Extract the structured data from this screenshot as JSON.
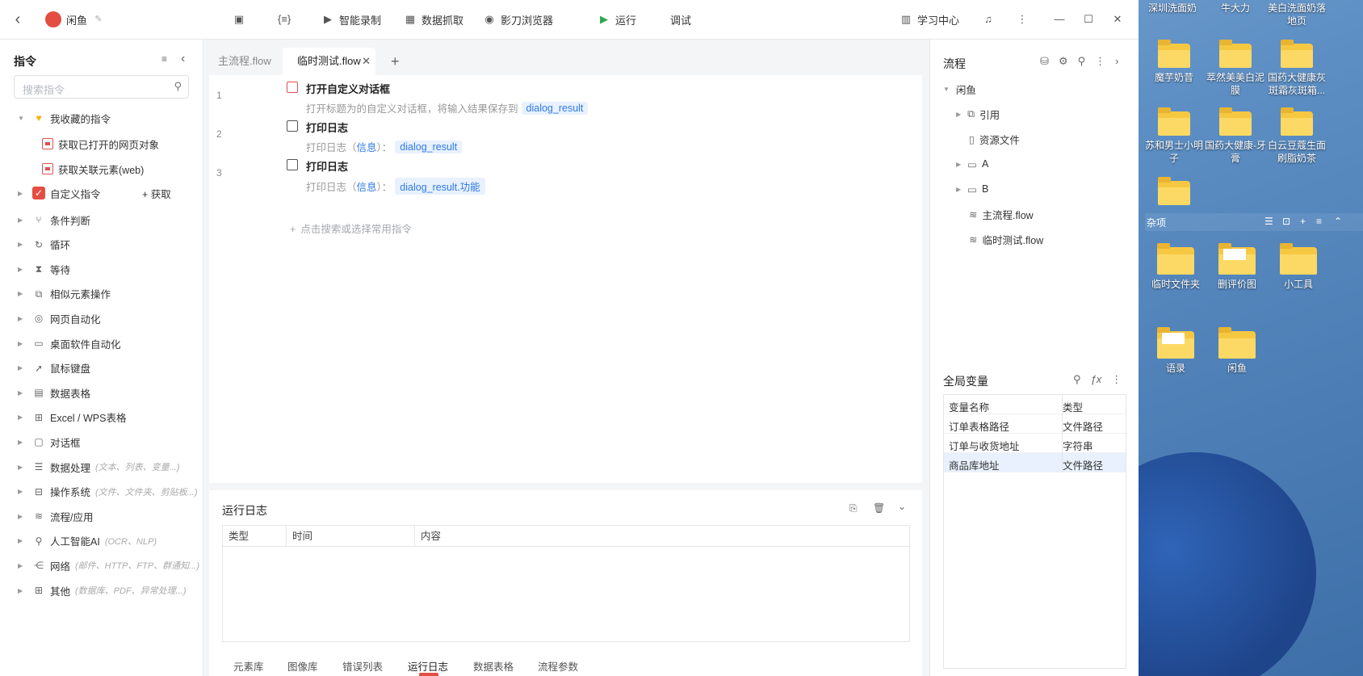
{
  "desktop": {
    "icons_top": [
      {
        "label": "深圳洗面奶"
      },
      {
        "label": "牛大力"
      },
      {
        "label": "美白洗面奶落地页"
      }
    ],
    "icons_row1": [
      {
        "label": "魔芋奶昔"
      },
      {
        "label": "萃然美美白泥膜"
      },
      {
        "label": "国药大健康灰斑霜灰斑箱..."
      }
    ],
    "icons_row2": [
      {
        "label": "苏和男士小明子"
      },
      {
        "label": "国药大健康-牙膏"
      },
      {
        "label": "白云豆蔻生面刷脂奶茶"
      }
    ],
    "group": {
      "label": "杂项"
    },
    "icons_row3": [
      {
        "label": "临时文件夹"
      },
      {
        "label": "删评价图"
      },
      {
        "label": "小工具"
      }
    ],
    "icons_row4": [
      {
        "label": "语录"
      },
      {
        "label": "闲鱼"
      }
    ]
  },
  "titlebar": {
    "back": "‹",
    "app_name": "闲鱼",
    "tools": {
      "smart_record": "智能录制",
      "data_capture": "数据抓取",
      "browser": "影刀浏览器",
      "run": "运行",
      "debug": "调试",
      "learn": "学习中心"
    }
  },
  "left": {
    "title": "指令",
    "search_placeholder": "搜索指令",
    "favorites": "我收藏的指令",
    "fav_items": [
      "获取已打开的网页对象",
      "获取关联元素(web)"
    ],
    "custom": "自定义指令",
    "custom_action": "+ 获取",
    "categories": [
      {
        "label": "条件判断",
        "hint": "",
        "icon": "branch-icon",
        "glyph": "⑂"
      },
      {
        "label": "循环",
        "hint": "",
        "icon": "loop-icon",
        "glyph": "↻"
      },
      {
        "label": "等待",
        "hint": "",
        "icon": "hourglass-icon",
        "glyph": "⧗"
      },
      {
        "label": "相似元素操作",
        "hint": "",
        "icon": "similar-icon",
        "glyph": "⧉"
      },
      {
        "label": "网页自动化",
        "hint": "",
        "icon": "web-icon",
        "glyph": "◎"
      },
      {
        "label": "桌面软件自动化",
        "hint": "",
        "icon": "desktop-icon",
        "glyph": "▭"
      },
      {
        "label": "鼠标键盘",
        "hint": "",
        "icon": "mouse-icon",
        "glyph": "➚"
      },
      {
        "label": "数据表格",
        "hint": "",
        "icon": "table-icon",
        "glyph": "▤"
      },
      {
        "label": "Excel / WPS表格",
        "hint": "",
        "icon": "excel-icon",
        "glyph": "⊞"
      },
      {
        "label": "对话框",
        "hint": "",
        "icon": "dialog-icon",
        "glyph": "▢"
      },
      {
        "label": "数据处理",
        "hint": "(文本、列表、变量...)",
        "icon": "data-icon",
        "glyph": "☰"
      },
      {
        "label": "操作系统",
        "hint": "(文件、文件夹、剪贴板...)",
        "icon": "os-icon",
        "glyph": "⊟"
      },
      {
        "label": "流程/应用",
        "hint": "",
        "icon": "layers-icon",
        "glyph": "≋"
      },
      {
        "label": "人工智能AI",
        "hint": "(OCR、NLP)",
        "icon": "ai-icon",
        "glyph": "⚲"
      },
      {
        "label": "网络",
        "hint": "(邮件、HTTP、FTP、群通知...)",
        "icon": "network-icon",
        "glyph": "⋲"
      },
      {
        "label": "其他",
        "hint": "(数据库、PDF、异常处理...)",
        "icon": "grid-icon",
        "glyph": "⊞"
      }
    ]
  },
  "tabs": [
    "主流程.flow",
    "临时测试.flow"
  ],
  "editor": {
    "steps": [
      {
        "num": "1",
        "title": "打开自定义对话框",
        "desc": "打开标题为的自定义对话框，将输入结果保存到",
        "tag": "dialog_result"
      },
      {
        "num": "2",
        "title": "打印日志",
        "desc": "打印日志（",
        "link": "信息",
        "desc2": "）：",
        "tag": "dialog_result"
      },
      {
        "num": "3",
        "title": "打印日志",
        "desc": "打印日志（",
        "link": "信息",
        "desc2": "）：",
        "tag": "dialog_result.功能"
      }
    ],
    "add_hint": "点击搜索或选择常用指令"
  },
  "log": {
    "title": "运行日志",
    "headers": [
      "类型",
      "时间",
      "内容"
    ],
    "bottom_tabs": [
      "元素库",
      "图像库",
      "错误列表",
      "运行日志",
      "数据表格",
      "流程参数"
    ]
  },
  "right": {
    "title": "流程",
    "tree": {
      "root": "闲鱼",
      "items": [
        "引用",
        "资源文件",
        "A",
        "B",
        "主流程.flow",
        "临时测试.flow"
      ]
    },
    "vars_title": "全局变量",
    "var_headers": [
      "变量名称",
      "类型"
    ],
    "vars": [
      {
        "name": "订单表格路径",
        "type": "文件路径"
      },
      {
        "name": "订单与收货地址",
        "type": "字符串"
      },
      {
        "name": "商品库地址",
        "type": "文件路径"
      }
    ]
  }
}
